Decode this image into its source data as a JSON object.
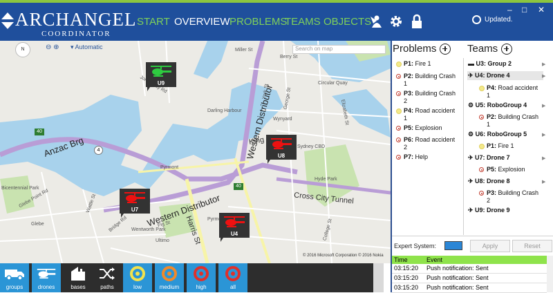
{
  "app": {
    "logo_text": "ARCHANGEL",
    "logo_sub": "COORDINATOR",
    "status": "Updated.",
    "window_controls": [
      "–",
      "□",
      "✕"
    ]
  },
  "nav": [
    {
      "label": "START",
      "active": false
    },
    {
      "label": "OVERVIEW",
      "active": true
    },
    {
      "label": "PROBLEMS",
      "active": false
    },
    {
      "label": "TEAMS",
      "active": false
    },
    {
      "label": "OBJECTS",
      "active": false
    }
  ],
  "header_icons": [
    "angel-icon",
    "gear-icon",
    "lock-icon"
  ],
  "map": {
    "search_placeholder": "Search on map",
    "mode": "Automatic",
    "zoom_out": "⊖",
    "zoom_in": "⊕",
    "compass": "N",
    "copyright": "© 2016 Microsoft Corporation  © 2016 Nokia",
    "big_roads": [
      "Anzac Brg",
      "Western Distributor",
      "Western Distributor",
      "Harris St",
      "Cross City Tunnel",
      "King St"
    ],
    "labels": [
      "Miller St",
      "Berry St",
      "York St",
      "George St",
      "Jones Bay Rd",
      "Pyrmont",
      "Glebe",
      "Ultimo",
      "Wentworth Park",
      "Bicentennial Park",
      "Glebe Point Rd",
      "Darling Harbour",
      "Wynyard",
      "Sydney CBD",
      "Circular Quay",
      "Hyde Park",
      "Elizabeth St",
      "College St",
      "Bridge Rd",
      "Fig St",
      "Wattle St",
      "Pyrmont Bridge Rd"
    ],
    "markers": [
      {
        "id": "U9",
        "color": "#2ecc40"
      },
      {
        "id": "U8",
        "color": "#ee1111"
      },
      {
        "id": "U7",
        "color": "#ee1111"
      },
      {
        "id": "U4",
        "color": "#ee1111"
      }
    ],
    "road_shields": [
      "40",
      "4",
      "40"
    ]
  },
  "toolbar": [
    {
      "label": "groups",
      "icon": "truck-icon",
      "style": "blue"
    },
    {
      "label": "drones",
      "icon": "helicopter-icon",
      "style": "blue"
    },
    {
      "label": "bases",
      "icon": "building-icon",
      "style": "dark"
    },
    {
      "label": "paths",
      "icon": "shuffle-icon",
      "style": "dark"
    },
    {
      "label": "low",
      "icon": "target-icon",
      "style": "blue",
      "ring": "#f2e24d"
    },
    {
      "label": "medium",
      "icon": "target-icon",
      "style": "blue",
      "ring": "#f08a2b"
    },
    {
      "label": "high",
      "icon": "target-icon",
      "style": "blue",
      "ring": "#e0302a"
    },
    {
      "label": "all",
      "icon": "target-icon",
      "style": "blue",
      "ring": "#e0302a"
    }
  ],
  "problems": {
    "title": "Problems",
    "items": [
      {
        "id": "P1:",
        "text": "Fire 1",
        "level": "low"
      },
      {
        "id": "P2:",
        "text": "Building Crash",
        "text2": "1",
        "level": "high"
      },
      {
        "id": "P3:",
        "text": "Building Crash",
        "text2": "2",
        "level": "high"
      },
      {
        "id": "P4:",
        "text": "Road accident",
        "text2": "1",
        "level": "low"
      },
      {
        "id": "P5:",
        "text": "Explosion",
        "level": "high"
      },
      {
        "id": "P6:",
        "text": "Road accident",
        "text2": "2",
        "level": "high"
      },
      {
        "id": "P7:",
        "text": "Help",
        "level": "high"
      }
    ]
  },
  "teams": {
    "title": "Teams",
    "items": [
      {
        "unit": "U3: Group 2",
        "sub": []
      },
      {
        "unit": "U4: Drone 4",
        "sub": [
          {
            "id": "P4:",
            "text": "Road accident",
            "text2": "1",
            "level": "low"
          }
        ]
      },
      {
        "unit": "U5: RoboGroup 4",
        "sub": [
          {
            "id": "P2:",
            "text": "Building Crash",
            "text2": "1",
            "level": "high"
          }
        ]
      },
      {
        "unit": "U6: RoboGroup 5",
        "sub": [
          {
            "id": "P1:",
            "text": "Fire 1",
            "level": "low"
          }
        ]
      },
      {
        "unit": "U7: Drone 7",
        "sub": [
          {
            "id": "P5:",
            "text": "Explosion",
            "level": "high"
          }
        ]
      },
      {
        "unit": "U8: Drone 8",
        "sub": [
          {
            "id": "P3:",
            "text": "Building Crash",
            "text2": "2",
            "level": "high"
          }
        ]
      },
      {
        "unit": "U9: Drone 9",
        "sub": []
      }
    ]
  },
  "expert": {
    "label": "Expert System:",
    "apply": "Apply",
    "reset": "Reset"
  },
  "log": {
    "col_time": "Time",
    "col_event": "Event",
    "rows": [
      {
        "time": "03:15:20",
        "event": "Push notification: Sent"
      },
      {
        "time": "03:15:20",
        "event": "Push notification: Sent"
      },
      {
        "time": "03:15:20",
        "event": "Push notification: Sent"
      }
    ]
  },
  "colors": {
    "header": "#1f4f9c",
    "accent_green": "#8cc63f",
    "nav_green": "#7fd15a",
    "toolbar_blue": "#2b95d6"
  }
}
